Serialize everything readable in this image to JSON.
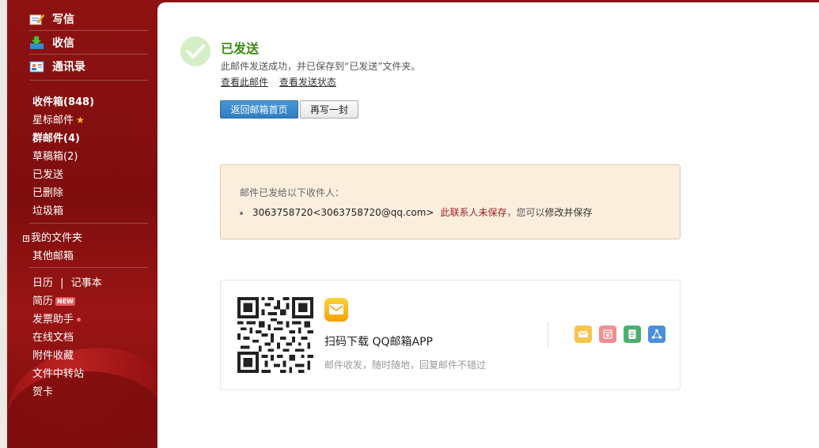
{
  "sidebar": {
    "compose": "写信",
    "receive": "收信",
    "contacts": "通讯录",
    "folders": [
      {
        "label": "收件箱(848)",
        "bold": true
      },
      {
        "label": "星标邮件",
        "bold": false
      },
      {
        "label": "群邮件(4)",
        "bold": true
      },
      {
        "label": "草稿箱(2)",
        "bold": false
      },
      {
        "label": "已发送",
        "bold": false
      },
      {
        "label": "已删除",
        "bold": false
      },
      {
        "label": "垃圾箱",
        "bold": false
      }
    ],
    "my_folders": "我的文件夹",
    "other_mailbox": "其他邮箱",
    "calendar": "日历",
    "separator": "|",
    "notebook": "记事本",
    "resume": "简历",
    "new_badge": "NEW",
    "invoice": "发票助手",
    "online_docs": "在线文档",
    "attachments": "附件收藏",
    "transfer": "文件中转站",
    "greeting_card": "贺卡"
  },
  "result": {
    "title": "已发送",
    "subtitle": "此邮件发送成功，并已保存到“已发送”文件夹。",
    "link_view": "查看此邮件",
    "link_status": "查看发送状态",
    "btn_home": "返回邮箱首页",
    "btn_rewrite": "再写一封"
  },
  "recipients": {
    "heading": "邮件已发给以下收件人：",
    "address": "3063758720<3063758720@qq.com>",
    "warning": "此联系人未保存",
    "hint": "，您可以",
    "fix": "修改并保存"
  },
  "app_promo": {
    "title": "扫码下载 QQ邮箱APP",
    "desc": "邮件收发，随时随地，回复邮件不错过",
    "icons": [
      "mail-app-icon",
      "calendar-app-icon",
      "notes-app-icon",
      "share-app-icon"
    ]
  },
  "colors": {
    "sidebar": "#8e1212",
    "success_green": "#3d8b12",
    "primary_button": "#2e7dc0",
    "notice_bg": "#fbeedd",
    "warning_red": "#a02020"
  }
}
